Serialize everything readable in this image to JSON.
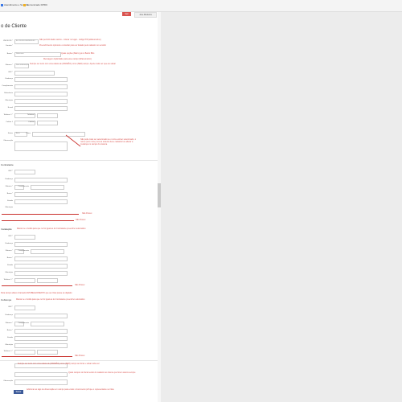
{
  "bookmarks": [
    "Atendimento e Suporte",
    "Comunicado DPDC"
  ],
  "topbar": {
    "red_btn": "Sair",
    "user_btn": "Jose Medeiros"
  },
  "title": "o de Cliente",
  "fields": {
    "cnpj_label": "CNPJ/CPF *",
    "cnpj_value": "Ex: 00.000.000/0000-00",
    "contato_label": "Contato *",
    "contato_value": "Sem informação",
    "bairro_label": "Bairro *",
    "bairro_value": "Selecione",
    "cep_label": "CEP *",
    "numero_label": "Número *",
    "numero_value": "Sem informação",
    "end_label": "Endereço",
    "complemento_label": "Complemento",
    "referencia_label": "Referência",
    "municipio_label": "Município",
    "estado_label": "Estado",
    "telefone1_label": "Telefone 1 *",
    "telefone2_label": "Telefone 2",
    "celular1_label": "Celular 1",
    "celular2_label": "Celular 2",
    "email_label": "E-mail",
    "status_label": "Status",
    "status_value": "Ativo",
    "plano_label": "Plano",
    "obs_label": "Observação",
    "observacao_label": "Observação"
  },
  "sections": {
    "contratante": "Contratante",
    "instalacao": "Instalação",
    "cobranca": "Cobrança",
    "same_addr": "Endereço de cobrança igual ao de instalação"
  },
  "notes": {
    "n1": "Não permitir dados vazios - colocar no lugar - código PIN (alfanumérico)",
    "n2": "Preenchimento opcional e consultar para ver Estado pelo cadastro no servidor",
    "n3": "Quais opções (Bairro) já no Bairro BDs",
    "n4": "Mensagem duplicidade para esse campo (Alfanumérico)",
    "n5": "Sempre ser texto com uma cadeia de (PADRÃO) como (SER) campo. Aperte toda vez que ele salvar",
    "n6": "Não pode mais ser selecionado se o nome estiver selecionado, o nome (sem nome) nos ao sistema deve cadastrar ou alterar a mudança no campo do sistema",
    "n7": "Não Possui",
    "n8": "Não Possui",
    "n9": "Marcar se o botão para que no for igual ao do Contratante preencher automático",
    "n10": "Não Possui",
    "n11": "Para campo abaixo chamado ESTABELECIMENTO que ao clicar passe ao digitado",
    "n12": "Marcar se o botão para que no for igual ao do Contratante preencher automático",
    "n13": "Não Possui",
    "n14": "Sempre ser texto com uma cadeia de (PADRÃO) como (SER) campo ao clicar e salvar toda vez",
    "n15": "Quais campos de fiscal sendo do cadastro ao cliente que forem salvos sempre",
    "n16": "Adicionar as tags de observação em campo para enviar o documento pdf que o representante ver lista"
  },
  "save_button": "Salvar",
  "colors": {
    "note": "#d9534f",
    "accent": "#3c5a99"
  }
}
